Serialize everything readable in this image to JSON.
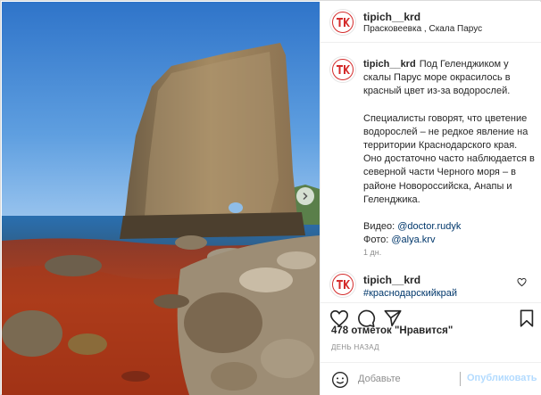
{
  "post": {
    "username": "tipich__krd",
    "location": "Прасковеевка , Скала Парус",
    "caption": {
      "username": "tipich__krd",
      "text1": "Под Геленджиком у скалы Парус море окрасилось в красный цвет из-за водорослей.",
      "text2": "Специалисты говорят, что цветение водорослей – не редкое явление на территории Краснодарского края. Оно достаточно часто наблюдается в северной части Черного моря – в районе Новороссийска, Анапы и Геленджика.",
      "video_label": "Видео: ",
      "video_handle": "@doctor.rudyk",
      "photo_label": "Фото: ",
      "photo_handle": "@alya.krv"
    },
    "time_ago": "1 дн.",
    "comment": {
      "username": "tipich__krd",
      "text": "#краснодарскийкрай"
    },
    "likes": "478 отметок \"Нравится\"",
    "date": "ДЕНЬ НАЗАД",
    "comment_placeholder": "Добавьте",
    "publish_label": "Опубликовать"
  },
  "icons": {
    "avatar": "tk-logo-icon",
    "next": "chevron-right-icon",
    "like": "heart-icon",
    "comment": "comment-icon",
    "share": "paper-plane-icon",
    "save": "bookmark-icon",
    "emoji": "smiley-icon"
  },
  "colors": {
    "brand_red": "#d42b2b",
    "link": "#00376b",
    "publish_disabled": "#b3dbff",
    "muted": "#8e8e8e"
  }
}
